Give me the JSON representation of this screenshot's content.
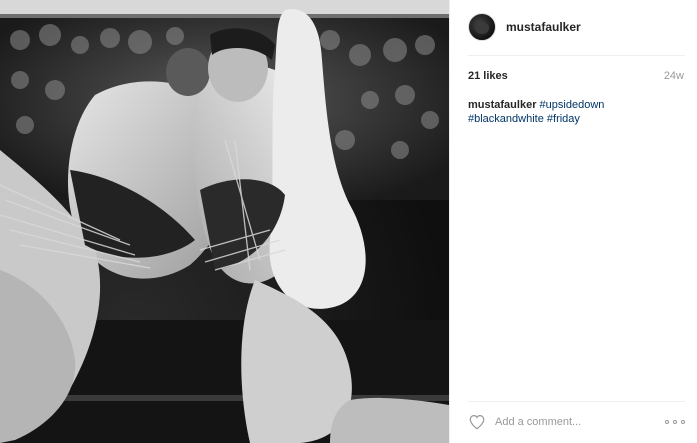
{
  "post": {
    "image_alt": "upside down black and white photo of two sumo wrestlers grappling",
    "colors": {
      "tag": "#003569",
      "muted": "#999999",
      "text": "#262626",
      "divider": "#efefef"
    }
  },
  "header": {
    "avatar_icon": "profile-avatar",
    "username": "mustafaulker"
  },
  "meta": {
    "likes": "21 likes",
    "age": "24w"
  },
  "caption": {
    "author": "mustafaulker",
    "tags": [
      "#upsidedown",
      "#blackandwhite",
      "#friday"
    ]
  },
  "comment_bar": {
    "like_icon": "heart-outline-icon",
    "placeholder": "Add a comment...",
    "more_icon": "ellipsis-icon"
  }
}
